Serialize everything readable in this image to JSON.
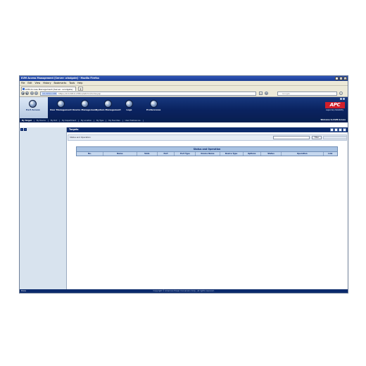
{
  "window": {
    "title": "KVM Access Management [Server: windgate] - Mozilla Firefox"
  },
  "menu": [
    "File",
    "Edit",
    "View",
    "History",
    "Bookmarks",
    "Tools",
    "Help"
  ],
  "browser_tab": {
    "label": "KVM Access Management [Server: windgate]",
    "new_tab": "+"
  },
  "address": {
    "host": "10.218.0.238",
    "rest": "https://10.218.0.238/ui/admin/home.jsp"
  },
  "search": {
    "placeholder": "Google"
  },
  "modules": [
    {
      "label": "Port Access",
      "active": true
    },
    {
      "label": "User Management"
    },
    {
      "label": "Device Management"
    },
    {
      "label": "System Management"
    },
    {
      "label": "Logs"
    },
    {
      "label": "Preferences"
    }
  ],
  "brand": {
    "logo": "APC",
    "tagline": "Legendary Reliability"
  },
  "subnav": {
    "items": [
      "By Target",
      "By Device",
      "By Port",
      "By Department",
      "By Location",
      "By Type",
      "My Favorites",
      "User Preferences"
    ],
    "welcome": "Welcome to KVM Access"
  },
  "targets": {
    "title": "Targets"
  },
  "filter": {
    "label": "Status and Operation",
    "button": "Filter"
  },
  "table": {
    "title": "Status and Operation",
    "columns": [
      "No.",
      "Name",
      "Slots",
      "Port",
      "Port Type",
      "Device Name",
      "Device Type",
      "Options",
      "Status",
      "Operation",
      "Link"
    ]
  },
  "footer": {
    "status": "Done",
    "copyright": "Copyright © American Power Conversion Corp., all rights reserved."
  }
}
